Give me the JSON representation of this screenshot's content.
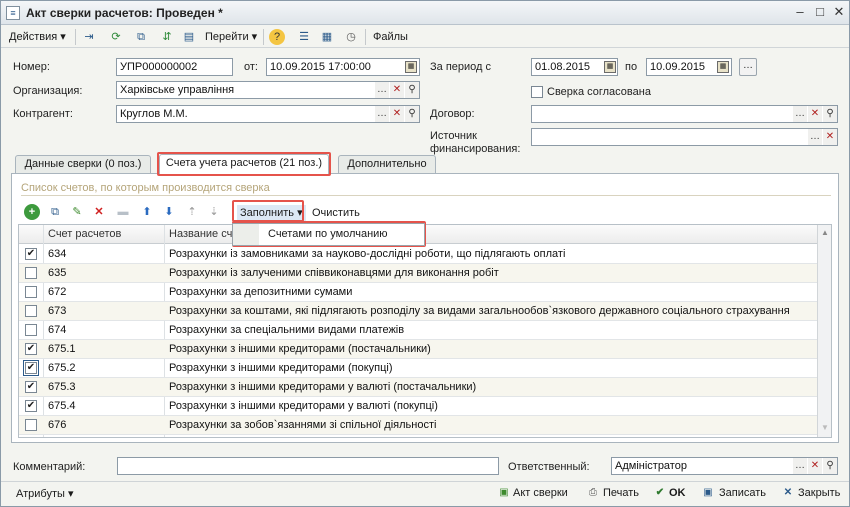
{
  "window": {
    "title": "Акт сверки расчетов: Проведен *"
  },
  "toolbar": {
    "actions": "Действия",
    "goto": "Перейти",
    "files": "Файлы"
  },
  "form": {
    "number_label": "Номер:",
    "number_value": "УПР000000002",
    "from_label": "от:",
    "date_value": "10.09.2015 17:00:00",
    "period_label": "За период с",
    "period_from": "01.08.2015",
    "period_to_label": "по",
    "period_to": "10.09.2015",
    "org_label": "Организация:",
    "org_value": "Харківське управління",
    "agreed_label": "Сверка согласована",
    "contractor_label": "Контрагент:",
    "contractor_value": "Круглов М.М.",
    "contract_label": "Договор:",
    "contract_value": "",
    "source_label_1": "Источник",
    "source_label_2": "финансирования:",
    "source_value": ""
  },
  "tabs": [
    {
      "label": "Данные сверки (0 поз.)"
    },
    {
      "label": "Счета учета расчетов (21 поз.)"
    },
    {
      "label": "Дополнительно"
    }
  ],
  "panel": {
    "section_title": "Список счетов, по которым производится сверка",
    "fill_button": "Заполнить",
    "clear_button": "Очистить",
    "dropdown_item": "Счетами по умолчанию"
  },
  "grid": {
    "col_account": "Счет расчетов",
    "col_name": "Название сче",
    "rows": [
      {
        "checked": "✔",
        "account": "634",
        "name": "Розрахунки із замовниками за науково-дослідні роботи, що підлягають оплаті"
      },
      {
        "checked": "",
        "account": "635",
        "name": "Розрахунки із залученими співвиконавцями для виконання робіт"
      },
      {
        "checked": "",
        "account": "672",
        "name": "Розрахунки за депозитними сумами"
      },
      {
        "checked": "",
        "account": "673",
        "name": "Розрахунки за коштами, які підлягають розподілу за видами загальнообов`язкового державного соціального страхування"
      },
      {
        "checked": "",
        "account": "674",
        "name": "Розрахунки за спеціальними видами платежів"
      },
      {
        "checked": "✔",
        "account": "675.1",
        "name": "Розрахунки з іншими кредиторами (постачальники)"
      },
      {
        "checked": "✔",
        "account": "675.2",
        "name": "Розрахунки з іншими кредиторами (покупці)"
      },
      {
        "checked": "✔",
        "account": "675.3",
        "name": "Розрахунки з іншими кредиторами у валюті (постачальники)"
      },
      {
        "checked": "✔",
        "account": "675.4",
        "name": "Розрахунки з іншими кредиторами у валюті (покупці)"
      },
      {
        "checked": "",
        "account": "676",
        "name": "Розрахунки за зобов`язаннями зі спільної діяльності"
      }
    ]
  },
  "footer": {
    "comment_label": "Комментарий:",
    "comment_value": "",
    "responsible_label": "Ответственный:",
    "responsible_value": "Адміністратор"
  },
  "statusbar": {
    "attributes": "Атрибуты",
    "act": "Акт сверки",
    "print": "Печать",
    "ok": "OK",
    "save": "Записать",
    "close": "Закрыть"
  },
  "colors": {
    "highlight": "#e5534b",
    "accent": "#2b5a8a"
  }
}
